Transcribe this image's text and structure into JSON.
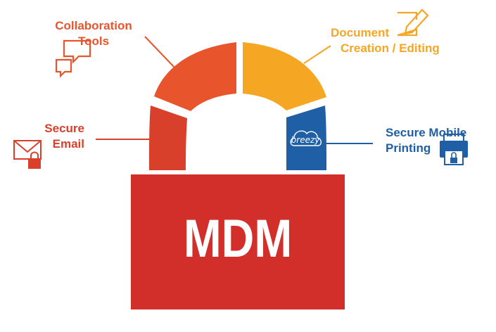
{
  "lock": {
    "center_label": "MDM",
    "body_color": "#d32f2a",
    "segments": [
      {
        "label_lines": [
          "Collaboration",
          "Tools"
        ],
        "color": "#e8552c",
        "icon": "chat-bubbles-icon"
      },
      {
        "label_lines": [
          "Document",
          "Creation / Editing"
        ],
        "color": "#f5a623",
        "icon": "edit-pencil-icon"
      },
      {
        "label_lines": [
          "Secure",
          "Email"
        ],
        "color": "#d9402b",
        "icon": "envelope-lock-icon"
      },
      {
        "label_lines": [
          "Secure Mobile",
          "Printing"
        ],
        "color": "#1f5fa6",
        "icon": "printer-lock-icon",
        "badge": "breezy"
      }
    ]
  }
}
